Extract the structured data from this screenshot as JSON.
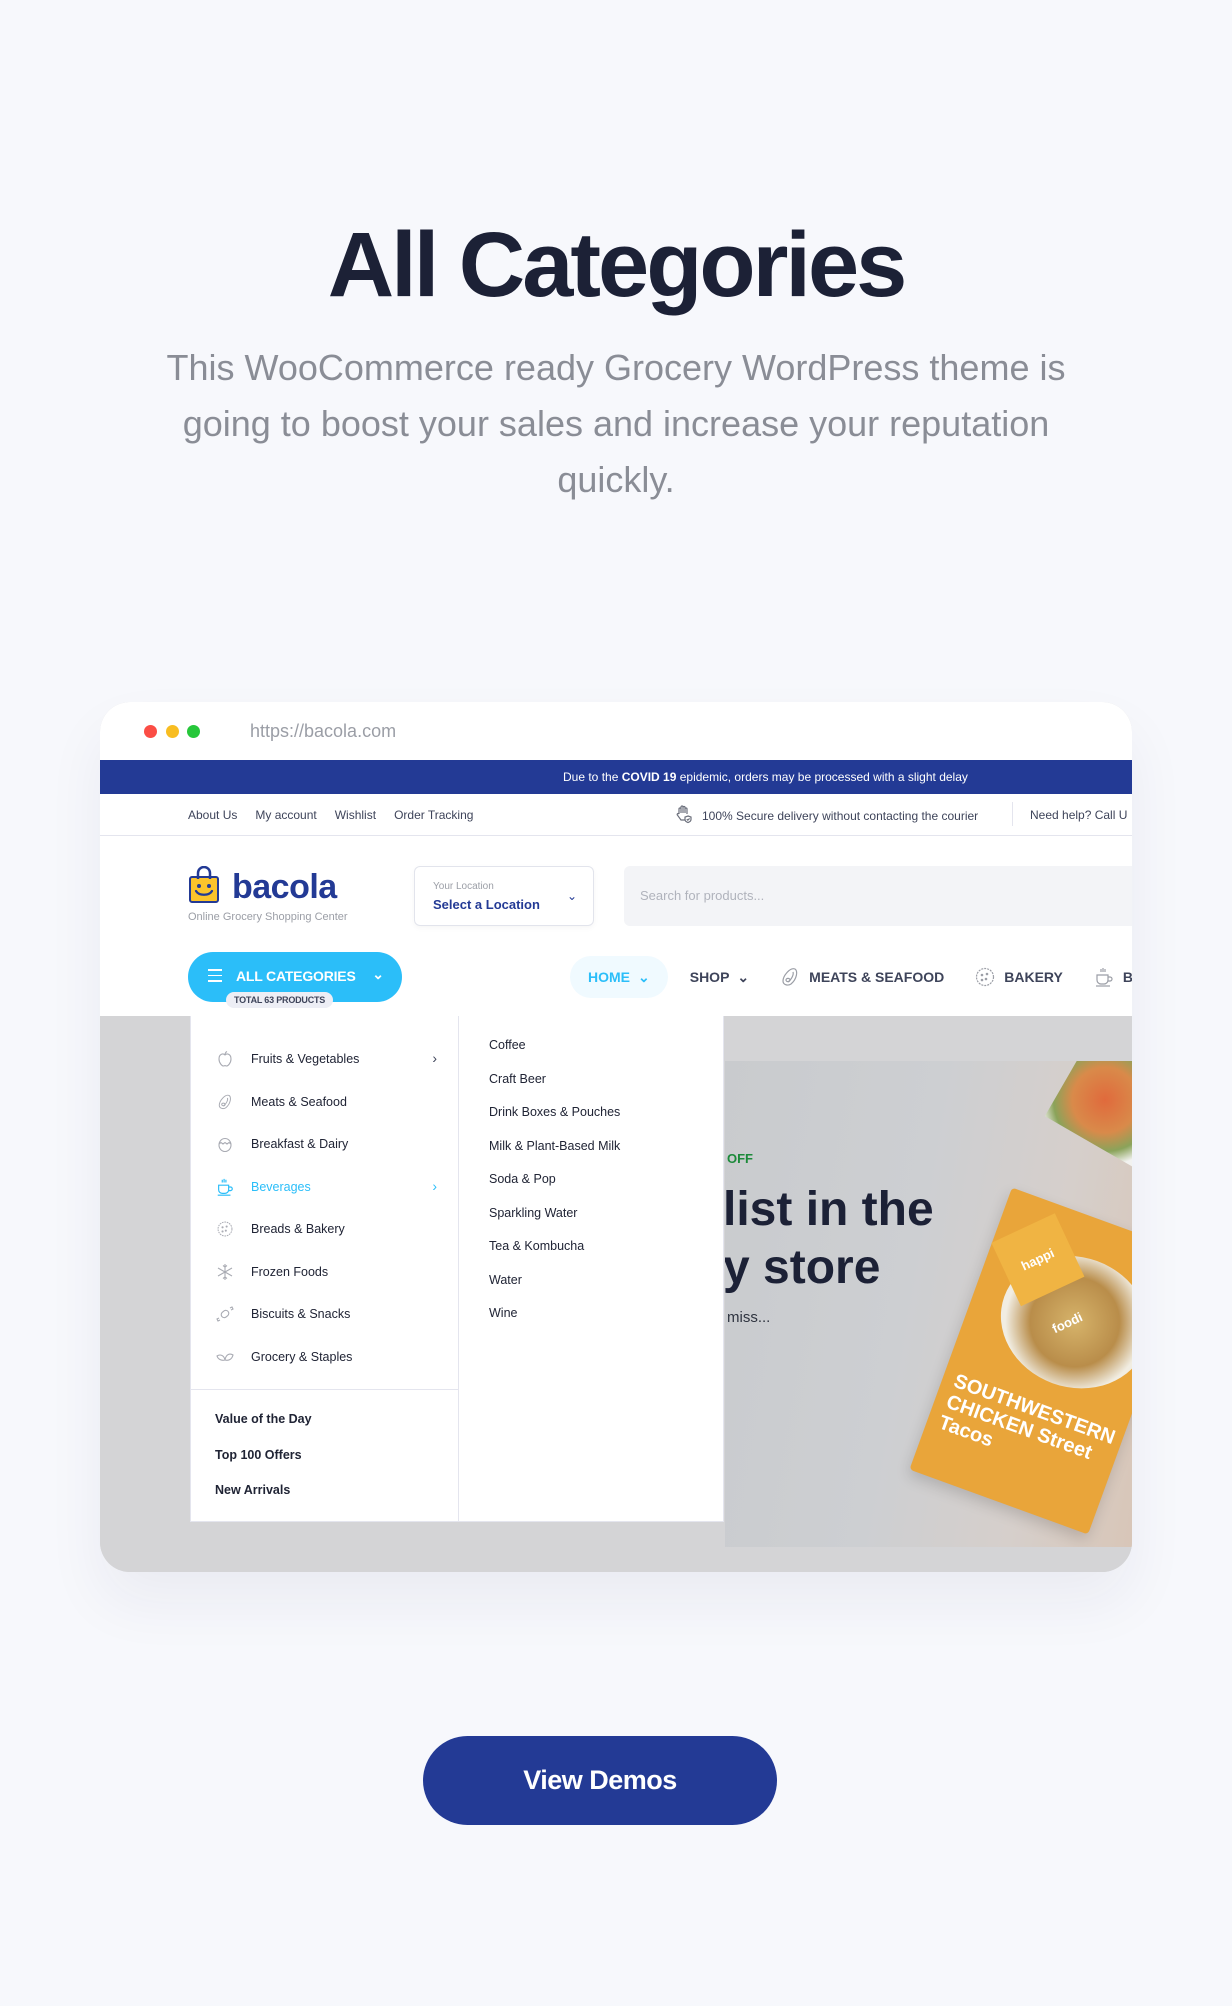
{
  "section": {
    "title": "All Categories",
    "subtitle": "This WooCommerce ready Grocery WordPress theme is going to boost your sales and increase your reputation quickly."
  },
  "browser": {
    "url": "https://bacola.com"
  },
  "notice": {
    "prefix": "Due to the ",
    "highlight": "COVID 19",
    "suffix": " epidemic, orders may be processed with a slight delay",
    "bg_color": "#233a95"
  },
  "topbar": {
    "links": [
      "About Us",
      "My account",
      "Wishlist",
      "Order Tracking"
    ],
    "secure_icon": "hand-shield-icon",
    "secure_text": "100% Secure delivery without contacting the courier",
    "help_text": "Need help? Call U"
  },
  "header": {
    "logo_text": "bacola",
    "logo_tagline": "Online Grocery Shopping Center",
    "location_label": "Your Location",
    "location_value": "Select a Location",
    "search_placeholder": "Search for products...",
    "all_categories_label": "ALL CATEGORIES",
    "total_products": "TOTAL 63 PRODUCTS",
    "accent_color": "#2bbef9",
    "brand_color": "#233a95"
  },
  "nav": {
    "items": [
      {
        "label": "HOME",
        "icon": "",
        "has_dropdown": true,
        "active": true
      },
      {
        "label": "SHOP",
        "icon": "",
        "has_dropdown": true,
        "active": false
      },
      {
        "label": "MEATS & SEAFOOD",
        "icon": "oyster-icon",
        "has_dropdown": false,
        "active": false
      },
      {
        "label": "BAKERY",
        "icon": "cookie-icon",
        "has_dropdown": false,
        "active": false
      },
      {
        "label": "BEV",
        "icon": "cup-icon",
        "has_dropdown": false,
        "active": false
      }
    ]
  },
  "menu": {
    "categories": [
      {
        "label": "Fruits & Vegetables",
        "icon": "apple-icon",
        "has_submenu": true,
        "active": false
      },
      {
        "label": "Meats & Seafood",
        "icon": "oyster-icon",
        "has_submenu": false,
        "active": false
      },
      {
        "label": "Breakfast & Dairy",
        "icon": "egg-icon",
        "has_submenu": false,
        "active": false
      },
      {
        "label": "Beverages",
        "icon": "cup-icon",
        "has_submenu": true,
        "active": true
      },
      {
        "label": "Breads & Bakery",
        "icon": "cookie-icon",
        "has_submenu": false,
        "active": false
      },
      {
        "label": "Frozen Foods",
        "icon": "snowflake-icon",
        "has_submenu": false,
        "active": false
      },
      {
        "label": "Biscuits & Snacks",
        "icon": "candy-icon",
        "has_submenu": false,
        "active": false
      },
      {
        "label": "Grocery & Staples",
        "icon": "leaf-icon",
        "has_submenu": false,
        "active": false
      }
    ],
    "extras": [
      "Value of the Day",
      "Top 100 Offers",
      "New Arrivals"
    ],
    "submenu": [
      "Coffee",
      "Craft Beer",
      "Drink Boxes & Pouches",
      "Milk & Plant-Based Milk",
      "Soda & Pop",
      "Sparkling Water",
      "Tea & Kombucha",
      "Water",
      "Wine"
    ]
  },
  "hero": {
    "badge": "OFF",
    "heading_line1": "list in the",
    "heading_line2": "y store",
    "subtext": "miss...",
    "product_brand": "happi foodi",
    "product_name": "SOUTHWESTERN CHICKEN Street Tacos"
  },
  "cta": {
    "label": "View Demos"
  }
}
